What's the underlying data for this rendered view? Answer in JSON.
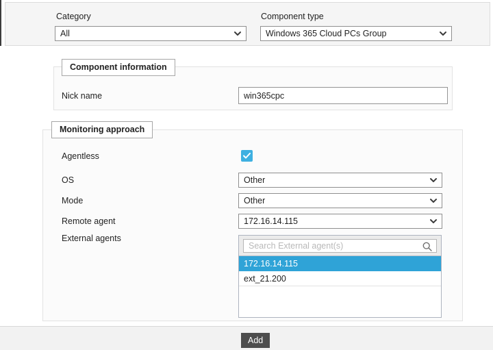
{
  "filters": {
    "category": {
      "label": "Category",
      "value": "All"
    },
    "component_type": {
      "label": "Component type",
      "value": "Windows 365 Cloud PCs Group"
    }
  },
  "component_information": {
    "legend": "Component information",
    "nick_name": {
      "label": "Nick name",
      "value": "win365cpc"
    }
  },
  "monitoring_approach": {
    "legend": "Monitoring approach",
    "agentless": {
      "label": "Agentless",
      "checked": true
    },
    "os": {
      "label": "OS",
      "value": "Other"
    },
    "mode": {
      "label": "Mode",
      "value": "Other"
    },
    "remote_agent": {
      "label": "Remote agent",
      "value": "172.16.14.115"
    },
    "external_agents": {
      "label": "External agents",
      "search_placeholder": "Search External agent(s)",
      "options": [
        {
          "label": "172.16.14.115",
          "selected": true
        },
        {
          "label": "ext_21.200",
          "selected": false
        }
      ]
    }
  },
  "footer": {
    "add_label": "Add"
  },
  "colors": {
    "selection_blue": "#2fa3d7",
    "checkbox_blue": "#3eb0e1",
    "button_dark": "#4d4d4d",
    "panel_gray": "#f5f5f5",
    "footer_gray": "#f2f2f2"
  }
}
